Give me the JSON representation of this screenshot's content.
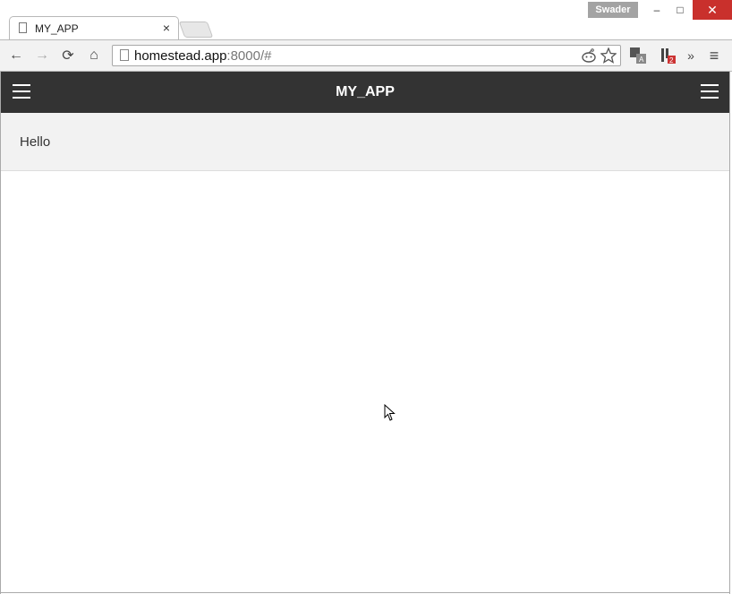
{
  "window": {
    "user_name": "Swader",
    "minimize": "–",
    "maximize": "□",
    "close": "✕"
  },
  "tab": {
    "title": "MY_APP",
    "close": "×"
  },
  "toolbar": {
    "back": "←",
    "forward": "→",
    "reload": "⟳",
    "home": "⌂",
    "url_host": "homestead.app",
    "url_rest": ":8000/#",
    "overflow": "»",
    "menu": "≡"
  },
  "app": {
    "title": "MY_APP"
  },
  "content": {
    "greeting": "Hello"
  }
}
